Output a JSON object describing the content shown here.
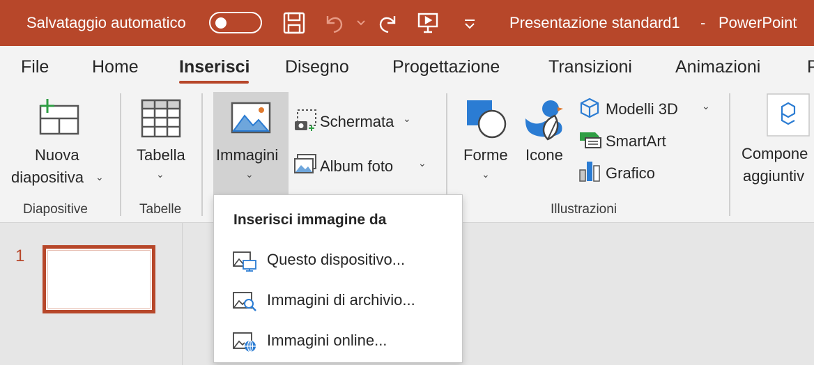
{
  "titlebar": {
    "autosave_label": "Salvataggio automatico",
    "title": "Presentazione standard1",
    "separator": "-",
    "app": "PowerPoint",
    "autosave_on": false
  },
  "tabs": [
    {
      "label": "File"
    },
    {
      "label": "Home"
    },
    {
      "label": "Inserisci",
      "active": true
    },
    {
      "label": "Disegno"
    },
    {
      "label": "Progettazione"
    },
    {
      "label": "Transizioni"
    },
    {
      "label": "Animazioni"
    },
    {
      "label": "P"
    }
  ],
  "ribbon": {
    "new_slide_line1": "Nuova",
    "new_slide_line2": "diapositiva",
    "table": "Tabella",
    "images": "Immagini",
    "screenshot": "Schermata",
    "photo_album": "Album foto",
    "shapes": "Forme",
    "icons": "Icone",
    "models3d": "Modelli 3D",
    "smartart": "SmartArt",
    "chart": "Grafico",
    "addins_line1": "Compone",
    "addins_line2": "aggiuntiv",
    "groups": {
      "slides": "Diapositive",
      "tables": "Tabelle",
      "illustrations": "Illustrazioni"
    }
  },
  "slides": [
    {
      "number": "1"
    }
  ],
  "dropdown": {
    "title": "Inserisci immagine da",
    "items": [
      {
        "label": "Questo dispositivo..."
      },
      {
        "label": "Immagini di archivio..."
      },
      {
        "label": "Immagini online..."
      }
    ]
  },
  "colors": {
    "accent": "#b7472a",
    "blue": "#2b7cd3"
  }
}
